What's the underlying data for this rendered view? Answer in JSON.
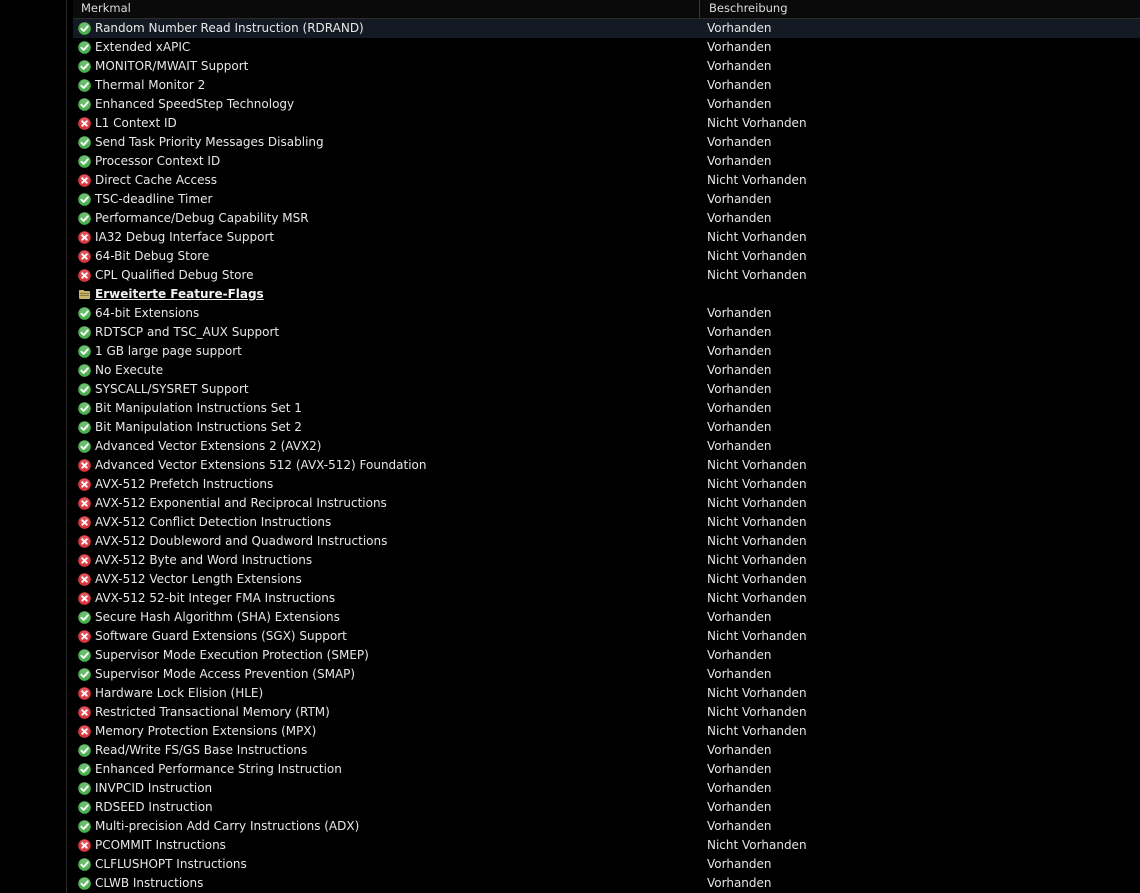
{
  "columns": {
    "feature": "Merkmal",
    "description": "Beschreibung"
  },
  "colors": {
    "ok": "#4caf50",
    "no": "#d9363e",
    "folder": "#c8b46a"
  },
  "rows": [
    {
      "icon": "ok",
      "label": "Random Number Read Instruction (RDRAND)",
      "value": "Vorhanden"
    },
    {
      "icon": "ok",
      "label": "Extended xAPIC",
      "value": "Vorhanden"
    },
    {
      "icon": "ok",
      "label": "MONITOR/MWAIT Support",
      "value": "Vorhanden"
    },
    {
      "icon": "ok",
      "label": "Thermal Monitor 2",
      "value": "Vorhanden"
    },
    {
      "icon": "ok",
      "label": "Enhanced SpeedStep Technology",
      "value": "Vorhanden"
    },
    {
      "icon": "no",
      "label": "L1 Context ID",
      "value": "Nicht Vorhanden"
    },
    {
      "icon": "ok",
      "label": "Send Task Priority Messages Disabling",
      "value": "Vorhanden"
    },
    {
      "icon": "ok",
      "label": "Processor Context ID",
      "value": "Vorhanden"
    },
    {
      "icon": "no",
      "label": "Direct Cache Access",
      "value": "Nicht Vorhanden"
    },
    {
      "icon": "ok",
      "label": "TSC-deadline Timer",
      "value": "Vorhanden"
    },
    {
      "icon": "ok",
      "label": "Performance/Debug Capability MSR",
      "value": "Vorhanden"
    },
    {
      "icon": "no",
      "label": "IA32 Debug Interface Support",
      "value": "Nicht Vorhanden"
    },
    {
      "icon": "no",
      "label": "64-Bit Debug Store",
      "value": "Nicht Vorhanden"
    },
    {
      "icon": "no",
      "label": "CPL Qualified Debug Store",
      "value": "Nicht Vorhanden"
    },
    {
      "icon": "section",
      "label": "Erweiterte Feature-Flags",
      "value": ""
    },
    {
      "icon": "ok",
      "label": "64-bit Extensions",
      "value": "Vorhanden"
    },
    {
      "icon": "ok",
      "label": "RDTSCP and TSC_AUX Support",
      "value": "Vorhanden"
    },
    {
      "icon": "ok",
      "label": "1 GB large page support",
      "value": "Vorhanden"
    },
    {
      "icon": "ok",
      "label": "No Execute",
      "value": "Vorhanden"
    },
    {
      "icon": "ok",
      "label": "SYSCALL/SYSRET Support",
      "value": "Vorhanden"
    },
    {
      "icon": "ok",
      "label": "Bit Manipulation Instructions Set 1",
      "value": "Vorhanden"
    },
    {
      "icon": "ok",
      "label": "Bit Manipulation Instructions Set 2",
      "value": "Vorhanden"
    },
    {
      "icon": "ok",
      "label": "Advanced Vector Extensions 2 (AVX2)",
      "value": "Vorhanden"
    },
    {
      "icon": "no",
      "label": "Advanced Vector Extensions 512 (AVX-512) Foundation",
      "value": "Nicht Vorhanden"
    },
    {
      "icon": "no",
      "label": "AVX-512 Prefetch Instructions",
      "value": "Nicht Vorhanden"
    },
    {
      "icon": "no",
      "label": "AVX-512 Exponential and Reciprocal Instructions",
      "value": "Nicht Vorhanden"
    },
    {
      "icon": "no",
      "label": "AVX-512 Conflict Detection Instructions",
      "value": "Nicht Vorhanden"
    },
    {
      "icon": "no",
      "label": "AVX-512 Doubleword and Quadword Instructions",
      "value": "Nicht Vorhanden"
    },
    {
      "icon": "no",
      "label": "AVX-512 Byte and Word Instructions",
      "value": "Nicht Vorhanden"
    },
    {
      "icon": "no",
      "label": "AVX-512 Vector Length Extensions",
      "value": "Nicht Vorhanden"
    },
    {
      "icon": "no",
      "label": "AVX-512 52-bit Integer FMA Instructions",
      "value": "Nicht Vorhanden"
    },
    {
      "icon": "ok",
      "label": "Secure Hash Algorithm (SHA) Extensions",
      "value": "Vorhanden"
    },
    {
      "icon": "no",
      "label": "Software Guard Extensions (SGX) Support",
      "value": "Nicht Vorhanden"
    },
    {
      "icon": "ok",
      "label": "Supervisor Mode Execution Protection (SMEP)",
      "value": "Vorhanden"
    },
    {
      "icon": "ok",
      "label": "Supervisor Mode Access Prevention (SMAP)",
      "value": "Vorhanden"
    },
    {
      "icon": "no",
      "label": "Hardware Lock Elision (HLE)",
      "value": "Nicht Vorhanden"
    },
    {
      "icon": "no",
      "label": "Restricted Transactional Memory (RTM)",
      "value": "Nicht Vorhanden"
    },
    {
      "icon": "no",
      "label": "Memory Protection Extensions (MPX)",
      "value": "Nicht Vorhanden"
    },
    {
      "icon": "ok",
      "label": "Read/Write FS/GS Base Instructions",
      "value": "Vorhanden"
    },
    {
      "icon": "ok",
      "label": "Enhanced Performance String Instruction",
      "value": "Vorhanden"
    },
    {
      "icon": "ok",
      "label": "INVPCID Instruction",
      "value": "Vorhanden"
    },
    {
      "icon": "ok",
      "label": "RDSEED Instruction",
      "value": "Vorhanden"
    },
    {
      "icon": "ok",
      "label": "Multi-precision Add Carry Instructions (ADX)",
      "value": "Vorhanden"
    },
    {
      "icon": "no",
      "label": "PCOMMIT Instructions",
      "value": "Nicht Vorhanden"
    },
    {
      "icon": "ok",
      "label": "CLFLUSHOPT Instructions",
      "value": "Vorhanden"
    },
    {
      "icon": "ok",
      "label": "CLWB Instructions",
      "value": "Vorhanden"
    }
  ]
}
